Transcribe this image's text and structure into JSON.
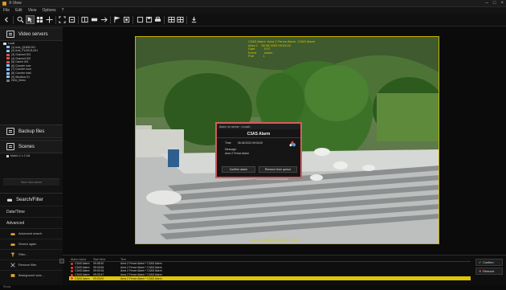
{
  "window": {
    "title": "X-View"
  },
  "menu": [
    "File",
    "Edit",
    "View",
    "Options",
    "?"
  ],
  "sidebar": {
    "video_servers": {
      "label": "Video servers"
    },
    "tree": [
      {
        "label": "Local",
        "color": "#d8d8d8"
      },
      {
        "label": "(1) Axis_Q1605-001",
        "color": "#8ac7ff"
      },
      {
        "label": "(2) Axis_P1425-B-001",
        "color": "#8ac7ff"
      },
      {
        "label": "(3) Channel 001",
        "color": "#e05050"
      },
      {
        "label": "(4) Channel 002",
        "color": "#e05050"
      },
      {
        "label": "(5) Camel 001",
        "color": "#e05050"
      },
      {
        "label": "(6) Counter now",
        "color": "#8ac7ff"
      },
      {
        "label": "(7) Counter hour",
        "color": "#8ac7ff"
      },
      {
        "label": "(8) Counter total",
        "color": "#8ac7ff"
      },
      {
        "label": "(9) Windbox 01",
        "color": "#8ac7ff"
      },
      {
        "label": "GEA_Demo",
        "color": "#777777"
      }
    ],
    "backup": {
      "label": "Backup files"
    },
    "scenes": {
      "label": "Scenes",
      "item": "Matrix 2 x 2 full"
    },
    "save_scene": "Save new scene",
    "search": {
      "label": "Search/Filter"
    },
    "datetime": "Date/Time",
    "advanced": "Advanced",
    "advanced_search": "Advanced search",
    "search_again": "Search again",
    "filter": "Filter...",
    "remove_filter": "Remove filter",
    "background_search": "Background sear..."
  },
  "video": {
    "overlay_top": "C3AS Alarm  Area 2 Fence Alarm  C3AS Alarm\nArea 2    08.08.2023 09:03:00\nDate          XYZ\nEvent         Alarm\nPort          1",
    "overlay_bottom": "Live 06.08.2023 09:03:00 · 00:00"
  },
  "dialog": {
    "header": "Alarm on server: <Local>",
    "title": "C3AS Alarm",
    "time_label": "Time:",
    "time_value": "06.08.2023 09:03:00",
    "message_label": "Message:",
    "message_value": "Area 2 Fence Alarm",
    "confirm": "Confirm alarm",
    "remove": "Remove from queue"
  },
  "alarms": {
    "columns": [
      "Alarm name",
      "Start time",
      "Text"
    ],
    "rows": [
      {
        "name": "C3AS Alarm",
        "time": "09:08:30",
        "text": "Area 2 Fence Alarm * C3AS Alarm"
      },
      {
        "name": "C3AS Alarm",
        "time": "09:03:06",
        "text": "Area 2 Fence Alarm * C3AS Alarm"
      },
      {
        "name": "C3AS Alarm",
        "time": "09:03:16",
        "text": "Area 2 Fence Alarm * C3AS Alarm"
      },
      {
        "name": "C3AS Alarm",
        "time": "09:03:47",
        "text": "Area 2 Fence Alarm * C3AS Alarm"
      },
      {
        "name": "C3AS Alarm",
        "time": "09:03:00",
        "text": "Area 2 Fence Alarm * C3AS Alarm"
      }
    ],
    "confirm_btn": "Confirm",
    "remove_btn": "Remove"
  },
  "status": "Ready",
  "colors": {
    "accent_yellow": "#e0c600",
    "alarm_red": "#d85b5b"
  },
  "icons": [
    "search-icon",
    "select-icon",
    "grid-icon",
    "move-icon",
    "fullscreen-icon",
    "layout-icon",
    "print-icon",
    "settings-icon"
  ]
}
